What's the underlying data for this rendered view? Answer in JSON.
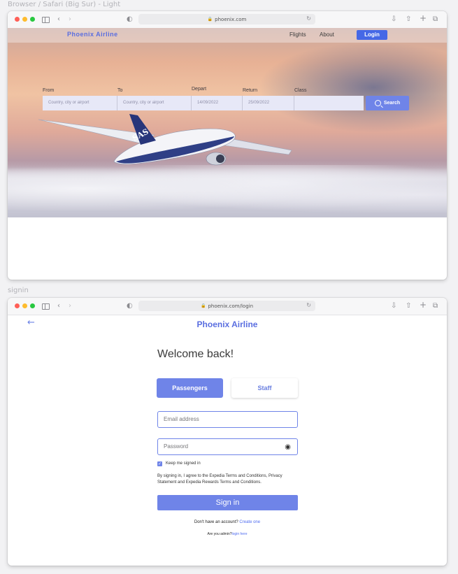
{
  "frames": {
    "home_caption": "Browser / Safari (Big Sur) - Light",
    "signin_caption": "signin"
  },
  "browser_home": {
    "url": "phoenix.com"
  },
  "browser_signin": {
    "url": "phoenix.com/login"
  },
  "colors": {
    "brand": "#5a6ee0",
    "accent": "#6f84e8",
    "login_button": "#4568e6"
  },
  "home": {
    "brand": "Phoenix Airline",
    "nav": {
      "flights": "Flights",
      "about": "About",
      "login": "Login"
    },
    "search": {
      "from_label": "From",
      "to_label": "To",
      "depart_label": "Depart",
      "return_label": "Return",
      "class_label": "Class",
      "from_placeholder": "Country, city or airport",
      "to_placeholder": "Country, city or airport",
      "depart_value": "14/09/2022",
      "return_value": "25/09/2022",
      "class_value": "",
      "button": "Search"
    }
  },
  "signin": {
    "brand": "Phoenix Airline",
    "heading": "Welcome back!",
    "tabs": {
      "passengers": "Passengers",
      "staff": "Staff"
    },
    "email_placeholder": "Email address",
    "password_placeholder": "Password",
    "keep_signed_in": "Keep me signed in",
    "keep_checked": true,
    "terms": "By signing in, I agree to the Expedia Terms and Conditions, Privacy Statement and Expedia Rewards Terms and Conditions.",
    "submit": "Sign in",
    "no_account": "Don't have an account?",
    "create_link": "Create one",
    "admin_text": "Are you admin?",
    "admin_link": "login here"
  }
}
